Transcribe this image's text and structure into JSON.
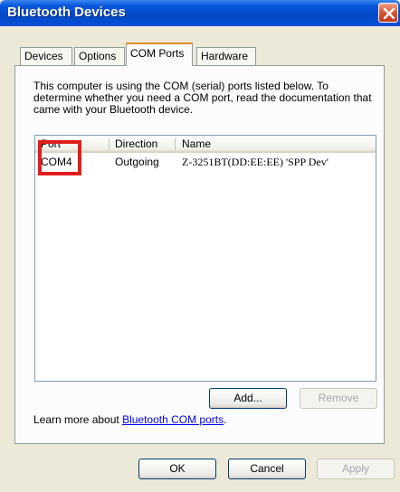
{
  "window": {
    "title": "Bluetooth Devices"
  },
  "tabs": [
    {
      "label": "Devices"
    },
    {
      "label": "Options"
    },
    {
      "label": "COM Ports"
    },
    {
      "label": "Hardware"
    }
  ],
  "panel": {
    "description": "This computer is using the COM (serial) ports listed below. To determine whether you need a COM port, read the documentation that came with your Bluetooth device."
  },
  "ports_table": {
    "columns": [
      "Port",
      "Direction",
      "Name"
    ],
    "rows": [
      {
        "port": "COM4",
        "direction": "Outgoing",
        "name": "Z-3251BT(DD:EE:EE) 'SPP Dev'"
      }
    ]
  },
  "panel_buttons": {
    "add": "Add...",
    "remove": "Remove"
  },
  "learn_more": {
    "prefix": "Learn more about ",
    "link": "Bluetooth COM ports",
    "suffix": "."
  },
  "dialog_buttons": {
    "ok": "OK",
    "cancel": "Cancel",
    "apply": "Apply"
  },
  "colors": {
    "highlight": "#e11c1c",
    "titlebar": "#0a58de"
  }
}
